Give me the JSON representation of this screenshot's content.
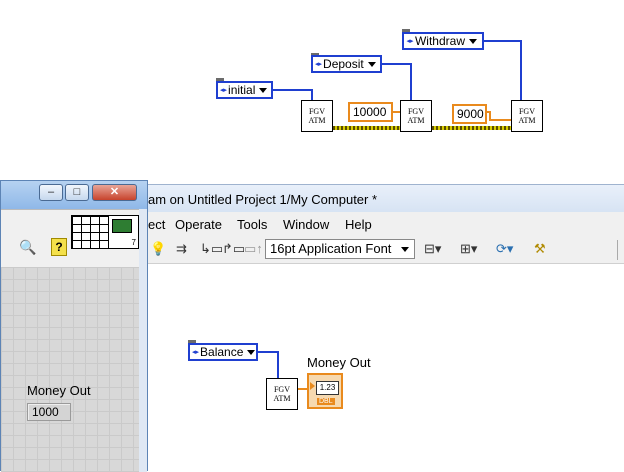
{
  "top_diagram": {
    "enum_initial": "initial",
    "enum_deposit": "Deposit",
    "enum_withdraw": "Withdraw",
    "const_deposit": "10000",
    "const_withdraw": "9000",
    "fgv_line1": "FGV",
    "fgv_line2": "ATM"
  },
  "block_diagram_window": {
    "title": "am on Untitled Project 1/My Computer *",
    "menu": [
      "ect",
      "Operate",
      "Tools",
      "Window",
      "Help"
    ],
    "font_selector": "16pt Application Font",
    "enum_balance": "Balance",
    "indicator_label": "Money Out",
    "indicator_type": "DBL",
    "indicator_glyph": "1.23"
  },
  "front_panel_window": {
    "minimize": "–",
    "maximize": "□",
    "close": "✕",
    "indicator_label": "Money Out",
    "indicator_value": "1000",
    "connector_count": "7"
  },
  "colors": {
    "enum_blue": "#1f3fd0",
    "numeric_orange": "#e98a1d",
    "panel_grid": "#d8d8d8",
    "window_blue": "#7cb0e6"
  }
}
